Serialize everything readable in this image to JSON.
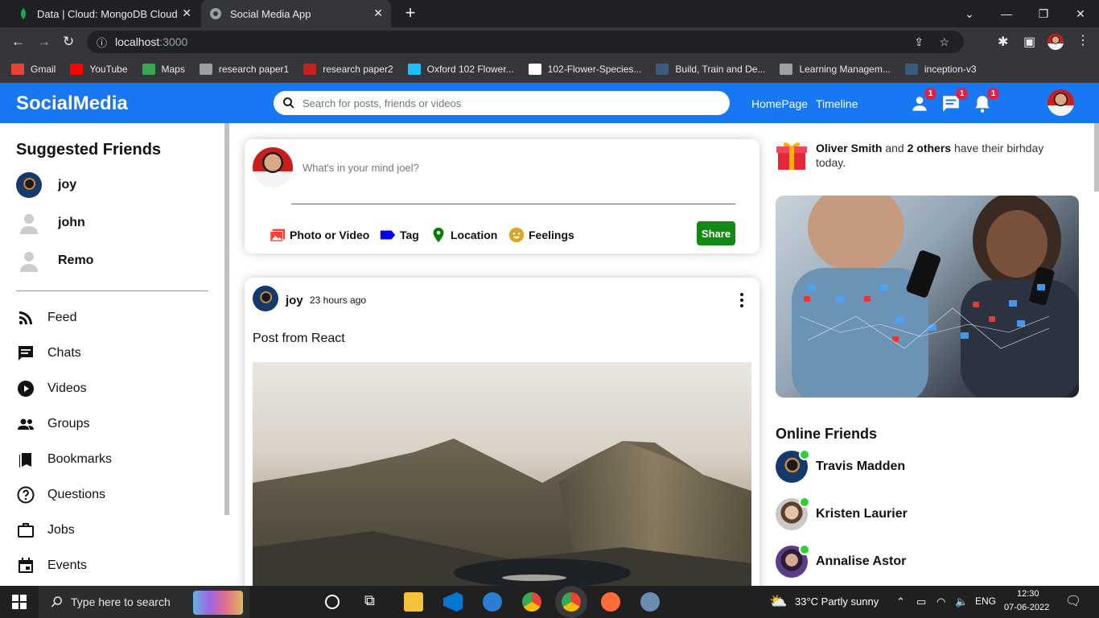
{
  "browser": {
    "tabs": [
      {
        "title": "Data | Cloud: MongoDB Cloud",
        "icon": "mongodb-leaf-icon"
      },
      {
        "title": "Social Media App",
        "icon": "globe-icon",
        "active": true
      }
    ],
    "url_host": "localhost",
    "url_port": ":3000",
    "bookmarks": [
      {
        "label": "Gmail",
        "icon": "gmail-icon",
        "color": "#ea4335"
      },
      {
        "label": "YouTube",
        "icon": "youtube-icon",
        "color": "#ff0000"
      },
      {
        "label": "Maps",
        "icon": "maps-icon",
        "color": "#34a853"
      },
      {
        "label": "research paper1",
        "icon": "globe-icon",
        "color": "#9aa0a6"
      },
      {
        "label": "research paper2",
        "icon": "red-dash-icon",
        "color": "#c5221f"
      },
      {
        "label": "Oxford 102 Flower...",
        "icon": "kaggle-icon",
        "color": "#20beff"
      },
      {
        "label": "102-Flower-Species...",
        "icon": "github-icon",
        "color": "#ffffff"
      },
      {
        "label": "Build, Train and De...",
        "icon": "tds-icon",
        "color": "#3c5a7a"
      },
      {
        "label": "Learning Managem...",
        "icon": "globe-icon",
        "color": "#9aa0a6"
      },
      {
        "label": "inception-v3",
        "icon": "tds-icon",
        "color": "#3c5a7a"
      }
    ]
  },
  "app": {
    "logo": "SocialMedia",
    "brand_color": "#1877f2",
    "search_placeholder": "Search for posts, friends or videos",
    "nav_links": [
      "HomePage",
      "Timeline"
    ],
    "badges": {
      "friends": "1",
      "messages": "1",
      "notifications": "1"
    }
  },
  "sidebar": {
    "suggested_title": "Suggested Friends",
    "friends": [
      {
        "name": "joy",
        "avatar": "photo"
      },
      {
        "name": "john",
        "avatar": "default-user-icon"
      },
      {
        "name": "Remo",
        "avatar": "default-user-icon"
      }
    ],
    "menu": [
      {
        "label": "Feed",
        "icon": "rss-feed-icon"
      },
      {
        "label": "Chats",
        "icon": "chat-icon"
      },
      {
        "label": "Videos",
        "icon": "play-circle-icon"
      },
      {
        "label": "Groups",
        "icon": "group-icon"
      },
      {
        "label": "Bookmarks",
        "icon": "bookmark-icon"
      },
      {
        "label": "Questions",
        "icon": "help-circle-icon"
      },
      {
        "label": "Jobs",
        "icon": "briefcase-icon"
      },
      {
        "label": "Events",
        "icon": "calendar-icon"
      }
    ]
  },
  "share": {
    "placeholder": "What's in your mind joel?",
    "options": [
      {
        "label": "Photo or Video",
        "icon": "photo-icon",
        "color": "#f44336"
      },
      {
        "label": "Tag",
        "icon": "label-icon",
        "color": "#0000ff"
      },
      {
        "label": "Location",
        "icon": "location-pin-icon",
        "color": "#008000"
      },
      {
        "label": "Feelings",
        "icon": "emoji-icon",
        "color": "#daa520"
      }
    ],
    "button": "Share"
  },
  "post": {
    "username": "joy",
    "time": "23 hours ago",
    "text": "Post from React"
  },
  "rightbar": {
    "birthday_name": "Oliver Smith",
    "birthday_and": " and ",
    "birthday_others": "2 others",
    "birthday_rest": " have their birhday today.",
    "online_title": "Online Friends",
    "online": [
      "Travis Madden",
      "Kristen Laurier",
      "Annalise Astor"
    ],
    "online_color": "#32cd32"
  },
  "taskbar": {
    "search_placeholder": "Type here to search",
    "weather": "33°C  Partly sunny",
    "lang": "ENG",
    "time": "12:30",
    "date": "07-06-2022"
  }
}
